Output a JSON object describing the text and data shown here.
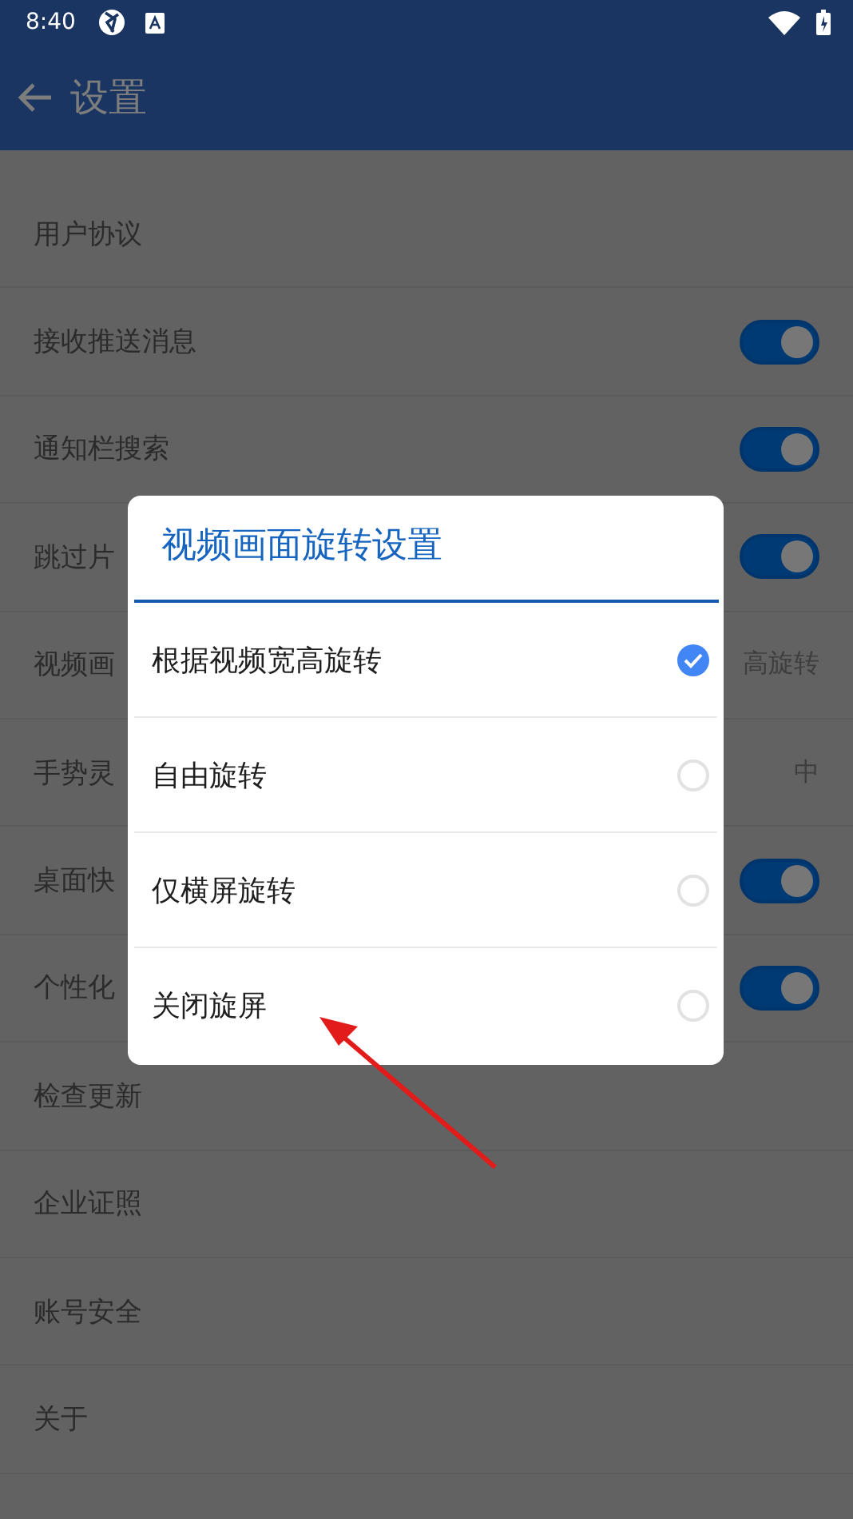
{
  "status_bar": {
    "time": "8:40"
  },
  "app_bar": {
    "title": "设置"
  },
  "settings": [
    {
      "kind": "plain",
      "label": "用户协议"
    },
    {
      "kind": "toggle",
      "label": "接收推送消息",
      "on": true
    },
    {
      "kind": "toggle",
      "label": "通知栏搜索",
      "on": true
    },
    {
      "kind": "toggle",
      "label": "跳过片",
      "on": true
    },
    {
      "kind": "value",
      "label": "视频画",
      "value": "高旋转"
    },
    {
      "kind": "value",
      "label": "手势灵",
      "value": "中"
    },
    {
      "kind": "toggle",
      "label": "桌面快",
      "on": true
    },
    {
      "kind": "toggle",
      "label": "个性化",
      "on": true
    },
    {
      "kind": "plain",
      "label": "检查更新"
    },
    {
      "kind": "plain",
      "label": "企业证照"
    },
    {
      "kind": "plain",
      "label": "账号安全"
    },
    {
      "kind": "plain",
      "label": "关于"
    }
  ],
  "dialog": {
    "title": "视频画面旋转设置",
    "options": [
      {
        "label": "根据视频宽高旋转",
        "selected": true
      },
      {
        "label": "自由旋转",
        "selected": false
      },
      {
        "label": "仅横屏旋转",
        "selected": false
      },
      {
        "label": "关闭旋屏",
        "selected": false
      }
    ]
  }
}
